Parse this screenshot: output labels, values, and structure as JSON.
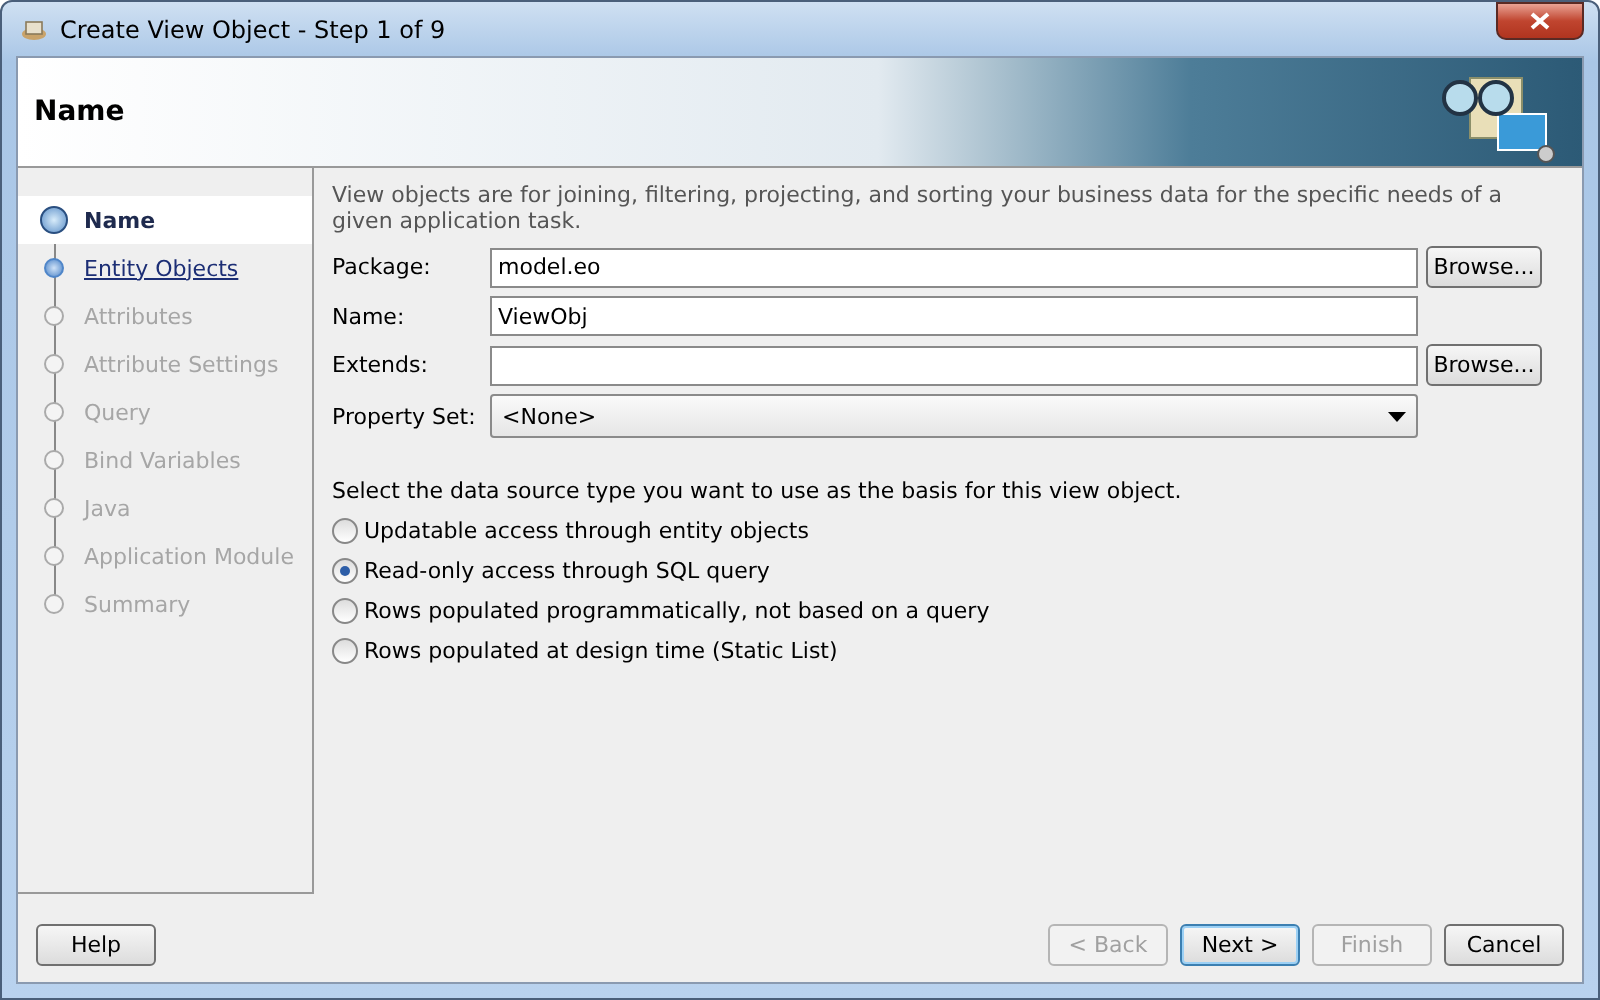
{
  "window": {
    "title": "Create View Object - Step 1 of 9"
  },
  "header": {
    "title": "Name"
  },
  "steps": [
    {
      "label": "Name",
      "selected": true,
      "disabled": false
    },
    {
      "label": "Entity Objects",
      "selected": false,
      "disabled": false
    },
    {
      "label": "Attributes",
      "selected": false,
      "disabled": true
    },
    {
      "label": "Attribute Settings",
      "selected": false,
      "disabled": true
    },
    {
      "label": "Query",
      "selected": false,
      "disabled": true
    },
    {
      "label": "Bind Variables",
      "selected": false,
      "disabled": true
    },
    {
      "label": "Java",
      "selected": false,
      "disabled": true
    },
    {
      "label": "Application Module",
      "selected": false,
      "disabled": true
    },
    {
      "label": "Summary",
      "selected": false,
      "disabled": true
    }
  ],
  "description": "View objects are for joining, filtering, projecting, and sorting your business data for the specific needs of a given application task.",
  "fields": [
    {
      "kind": "text",
      "label": "Package:",
      "value": "model.eo",
      "button": "Browse..."
    },
    {
      "kind": "text",
      "label": "Name:",
      "value": "ViewObj"
    },
    {
      "kind": "text",
      "label": "Extends:",
      "button": "Browse..."
    },
    {
      "kind": "select",
      "label": "Property Set:",
      "value": "<None>"
    }
  ],
  "source_prompt": "Select the data source type you want to use as the basis for this view object.",
  "source_options": [
    {
      "label": "Updatable access through entity objects",
      "selected": false
    },
    {
      "label": "Read-only access through SQL query",
      "selected": true
    },
    {
      "label": "Rows populated programmatically, not based on a query",
      "selected": false
    },
    {
      "label": "Rows populated at design time (Static List)",
      "selected": false
    }
  ],
  "buttons": [
    {
      "label": "Help",
      "disabled": false,
      "default": false
    },
    {
      "label": "< Back",
      "disabled": true,
      "default": false
    },
    {
      "label": "Next >",
      "disabled": false,
      "default": true
    },
    {
      "label": "Finish",
      "disabled": true,
      "default": false
    },
    {
      "label": "Cancel",
      "disabled": false,
      "default": false
    }
  ]
}
